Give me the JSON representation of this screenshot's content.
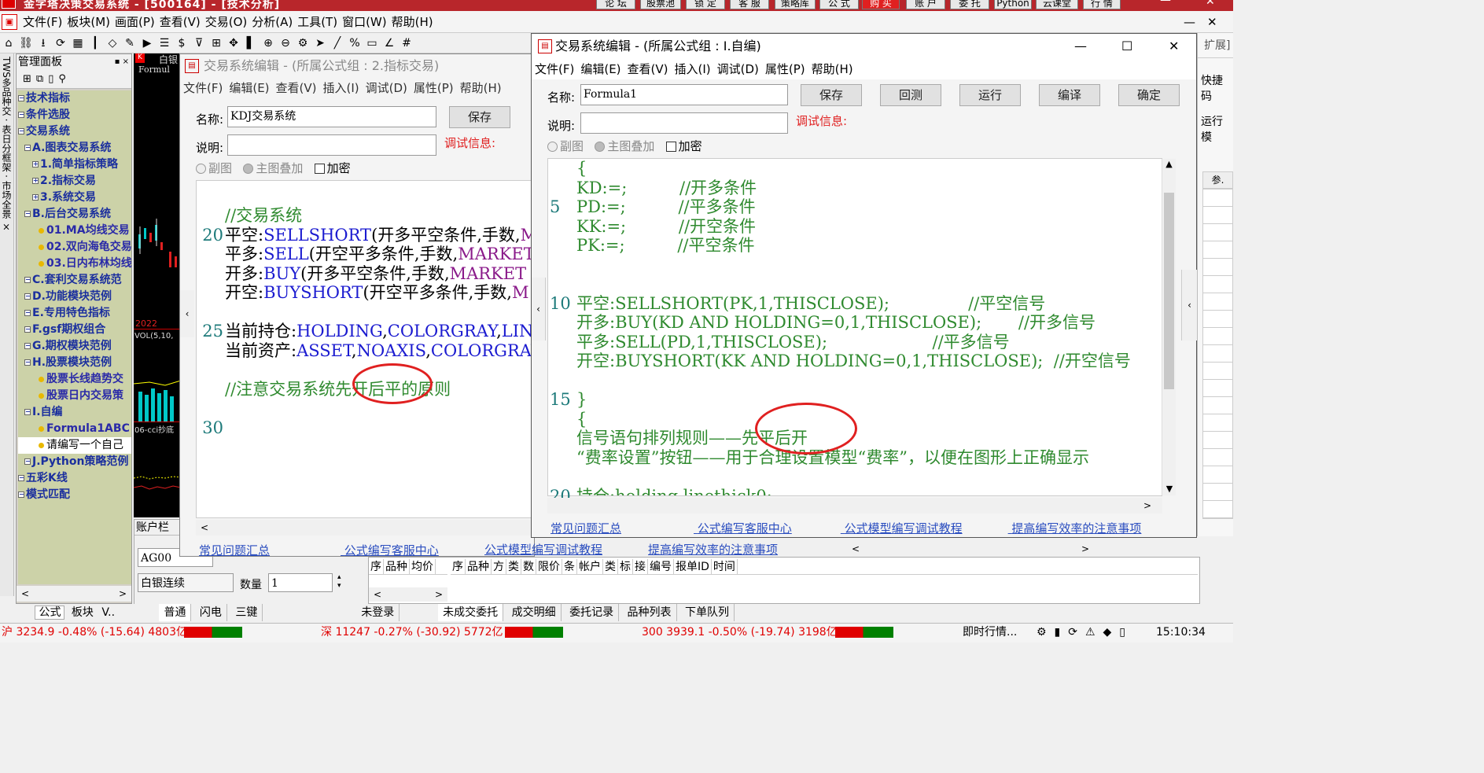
{
  "app": {
    "title": "金字塔决策交易系统 - [500164] - [技术分析]",
    "top_buttons": [
      "论 坛",
      "股票池",
      "锁 定",
      "客 服",
      "策略库",
      "公 式",
      "购 买",
      "账 户",
      "委 托",
      "Python",
      "云课堂",
      "行 情"
    ]
  },
  "menu": [
    "文件(F)",
    "板块(M)",
    "画面(P)",
    "查看(V)",
    "交易(O)",
    "分析(A)",
    "工具(T)",
    "窗口(W)",
    "帮助(H)"
  ],
  "toolbar_icons": [
    "home-icon",
    "link-icon",
    "download-icon",
    "refresh-icon",
    "grid-icon",
    "candle-icon",
    "diamond-icon",
    "edit-icon",
    "play-icon",
    "list-icon",
    "dollar-icon",
    "funnel-icon",
    "table-icon",
    "move-icon",
    "bar-icon",
    "zoom-in-icon",
    "zoom-out-icon",
    "gear-icon",
    "cursor-icon",
    "line-icon",
    "percent-icon",
    "ruler-icon",
    "angle-icon",
    "hash-icon"
  ],
  "left_strip": "TWS多品种交 · 表日分框架 · 市场全景 ×",
  "panel": {
    "title": "管理面板",
    "tree": [
      {
        "label": "技术指标",
        "level": 1
      },
      {
        "label": "条件选股",
        "level": 1
      },
      {
        "label": "交易系统",
        "level": 1
      },
      {
        "label": "A.图表交易系统",
        "level": 2
      },
      {
        "label": "1.简单指标策略",
        "level": 3
      },
      {
        "label": "2.指标交易",
        "level": 3
      },
      {
        "label": "3.系统交易",
        "level": 3
      },
      {
        "label": "B.后台交易系统",
        "level": 2
      },
      {
        "label": "01.MA均线交易",
        "level": 4
      },
      {
        "label": "02.双向海龟交易",
        "level": 4
      },
      {
        "label": "03.日内布林均线",
        "level": 4
      },
      {
        "label": "C.套利交易系统范",
        "level": 2
      },
      {
        "label": "D.功能模块范例",
        "level": 2
      },
      {
        "label": "E.专用特色指标",
        "level": 2
      },
      {
        "label": "F.gsf期权组合",
        "level": 2
      },
      {
        "label": "G.期权模块范例",
        "level": 2
      },
      {
        "label": "H.股票模块范例",
        "level": 2
      },
      {
        "label": "股票长线趋势交",
        "level": 4
      },
      {
        "label": "股票日内交易策",
        "level": 4
      },
      {
        "label": "I.自编",
        "level": 2
      },
      {
        "label": "Formula1ABC",
        "level": 4
      },
      {
        "label": "请编写一个自己",
        "level": 5
      },
      {
        "label": "J.Python策略范例",
        "level": 2
      },
      {
        "label": "五彩K线",
        "level": 1
      },
      {
        "label": "模式匹配",
        "level": 1
      }
    ],
    "bottom_tabs": [
      "公式",
      "板块",
      "V.."
    ]
  },
  "chart": {
    "label_top": "白银",
    "label_formula": "Formul",
    "year": "2022",
    "vol": "VOL(5,10,",
    "cci": "06-cci抄底"
  },
  "account": {
    "title": "账户栏",
    "code": "AG00",
    "name": "白银连续",
    "qty_label": "数量",
    "qty": "1",
    "tabs": [
      "普通",
      "闪电",
      "三键"
    ],
    "status": "未登录"
  },
  "orders": {
    "cols_a": [
      "序",
      "品种",
      "均价"
    ],
    "cols_b": [
      "序",
      "品种",
      "方",
      "类",
      "数",
      "限价",
      "条",
      "帐户",
      "类",
      "标",
      "接",
      "编号",
      "报单ID",
      "时间"
    ],
    "tabs": [
      "未成交委托",
      "成交明细",
      "委托记录",
      "品种列表",
      "下单队列"
    ]
  },
  "statusbar": {
    "sh": "沪 3234.9 -0.48% (-15.64) 4803亿",
    "sz": "深 11247 -0.27% (-30.92) 5772亿",
    "i300": "300 3939.1 -0.50% (-19.74) 3198亿",
    "rt": "即时行情...",
    "time": "15:10:34"
  },
  "win1": {
    "title": "交易系统编辑 - (所属公式组 : 2.指标交易)",
    "menu": [
      "文件(F)",
      "编辑(E)",
      "查看(V)",
      "插入(I)",
      "调试(D)",
      "属性(P)",
      "帮助(H)"
    ],
    "name_label": "名称:",
    "name_value": "KDJ交易系统",
    "desc_label": "说明:",
    "save": "保存",
    "debug": "调试信息:",
    "opt1": "副图",
    "opt2": "主图叠加",
    "opt3": "加密",
    "line_numbers": [
      "20",
      "25",
      "30"
    ],
    "links": [
      "常见问题汇总",
      "公式编写客服中心",
      "公式模型编写调试教程",
      "提高编写效率的注意事项"
    ]
  },
  "win2": {
    "title": "交易系统编辑 - (所属公式组 : I.自编)",
    "menu": [
      "文件(F)",
      "编辑(E)",
      "查看(V)",
      "插入(I)",
      "调试(D)",
      "属性(P)",
      "帮助(H)"
    ],
    "name_label": "名称:",
    "name_value": "Formula1",
    "desc_label": "说明:",
    "debug": "调试信息:",
    "buttons": [
      "保存",
      "回测",
      "运行",
      "编译",
      "确定"
    ],
    "opt1": "副图",
    "opt2": "主图叠加",
    "opt3": "加密",
    "line_numbers": [
      "5",
      "10",
      "15",
      "20"
    ],
    "links": [
      "常见问题汇总",
      "公式编写客服中心",
      "公式模型编写调试教程",
      "提高编写效率的注意事项"
    ]
  },
  "right_panel": {
    "title": "扩展]",
    "l1": "快捷码",
    "l2": "运行模",
    "col": "参."
  }
}
